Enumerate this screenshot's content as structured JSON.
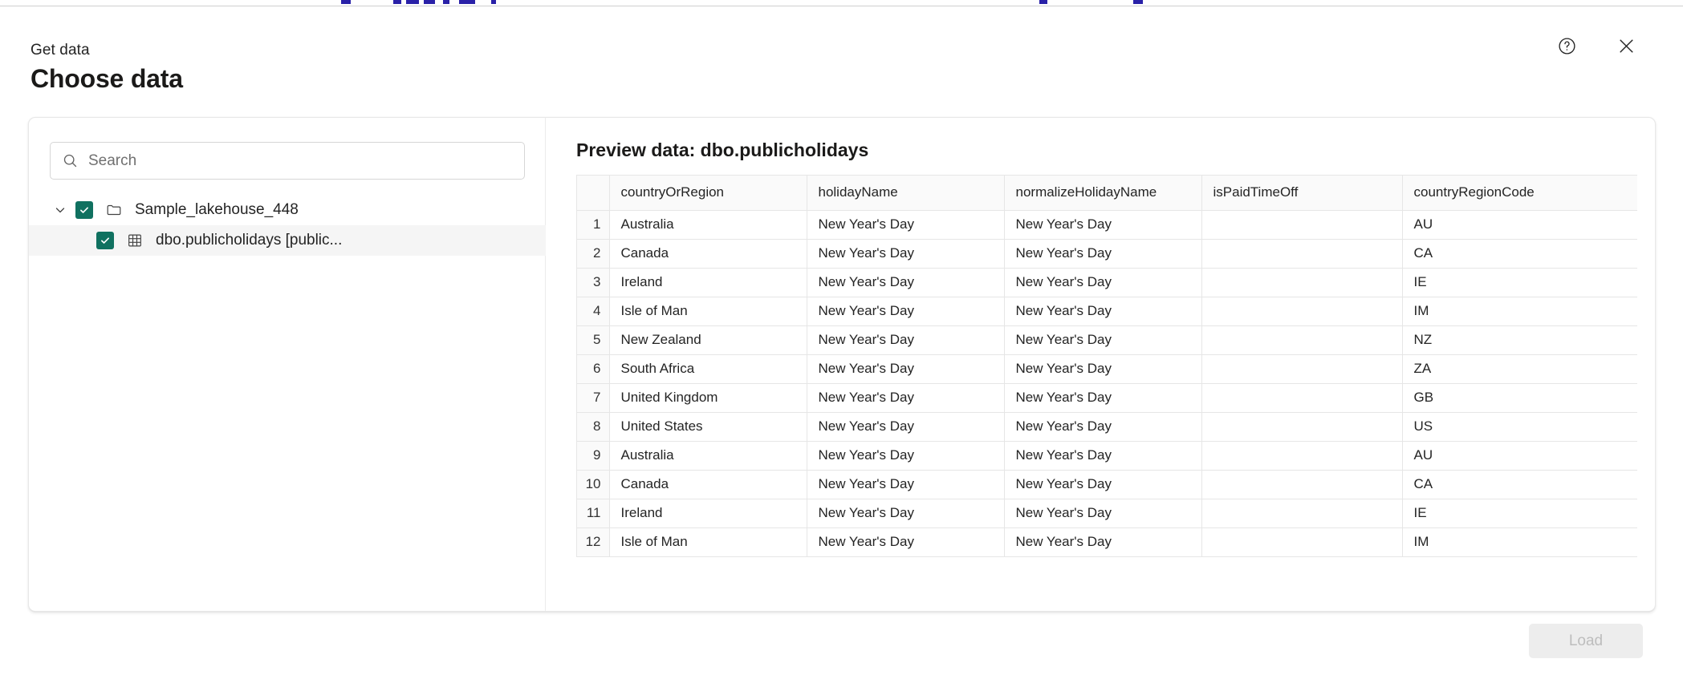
{
  "dialog": {
    "eyebrow": "Get data",
    "title": "Choose data",
    "help_icon": "help-circle-icon",
    "close_icon": "close-icon"
  },
  "search": {
    "placeholder": "Search",
    "value": "",
    "icon": "search-icon"
  },
  "tree": {
    "items": [
      {
        "label": "Sample_lakehouse_448",
        "level": 0,
        "checked": true,
        "expanded": true,
        "icon": "folder-icon",
        "selected": false
      },
      {
        "label": "dbo.publicholidays [public...",
        "level": 1,
        "checked": true,
        "expanded": null,
        "icon": "table-grid-icon",
        "selected": true
      }
    ]
  },
  "preview": {
    "title": "Preview data: dbo.publicholidays",
    "columns": [
      "countryOrRegion",
      "holidayName",
      "normalizeHolidayName",
      "isPaidTimeOff",
      "countryRegionCode"
    ],
    "rows": [
      {
        "num": "1",
        "cells": [
          "Australia",
          "New Year's Day",
          "New Year's Day",
          "",
          "AU"
        ]
      },
      {
        "num": "2",
        "cells": [
          "Canada",
          "New Year's Day",
          "New Year's Day",
          "",
          "CA"
        ]
      },
      {
        "num": "3",
        "cells": [
          "Ireland",
          "New Year's Day",
          "New Year's Day",
          "",
          "IE"
        ]
      },
      {
        "num": "4",
        "cells": [
          "Isle of Man",
          "New Year's Day",
          "New Year's Day",
          "",
          "IM"
        ]
      },
      {
        "num": "5",
        "cells": [
          "New Zealand",
          "New Year's Day",
          "New Year's Day",
          "",
          "NZ"
        ]
      },
      {
        "num": "6",
        "cells": [
          "South Africa",
          "New Year's Day",
          "New Year's Day",
          "",
          "ZA"
        ]
      },
      {
        "num": "7",
        "cells": [
          "United Kingdom",
          "New Year's Day",
          "New Year's Day",
          "",
          "GB"
        ]
      },
      {
        "num": "8",
        "cells": [
          "United States",
          "New Year's Day",
          "New Year's Day",
          "",
          "US"
        ]
      },
      {
        "num": "9",
        "cells": [
          "Australia",
          "New Year's Day",
          "New Year's Day",
          "",
          "AU"
        ]
      },
      {
        "num": "10",
        "cells": [
          "Canada",
          "New Year's Day",
          "New Year's Day",
          "",
          "CA"
        ]
      },
      {
        "num": "11",
        "cells": [
          "Ireland",
          "New Year's Day",
          "New Year's Day",
          "",
          "IE"
        ]
      },
      {
        "num": "12",
        "cells": [
          "Isle of Man",
          "New Year's Day",
          "New Year's Day",
          "",
          "IM"
        ]
      }
    ]
  },
  "footer": {
    "load_label": "Load",
    "load_disabled": true
  },
  "colors": {
    "checkbox_green": "#107160",
    "panel_border": "#e8e8e8",
    "table_border": "#e6e6e6",
    "header_bg": "#fafafa",
    "selected_row_bg": "#f5f5f5",
    "disabled_button_bg": "#ededed",
    "disabled_button_text": "#bdbdbd",
    "title_text": "#1b1a19",
    "body_text": "#242424"
  }
}
